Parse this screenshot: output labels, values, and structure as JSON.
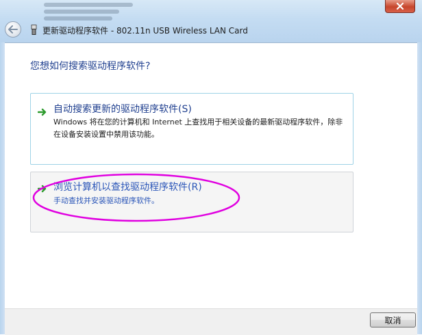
{
  "window": {
    "title": "更新驱动程序软件 - 802.11n USB Wireless LAN Card"
  },
  "content": {
    "question": "您想如何搜索驱动程序软件?",
    "options": [
      {
        "title": "自动搜索更新的驱动程序软件(S)",
        "description": "Windows 将在您的计算机和 Internet 上查找用于相关设备的最新驱动程序软件，除非在设备安装设置中禁用该功能。"
      },
      {
        "title": "浏览计算机以查找驱动程序软件(R)",
        "description": "手动查找并安装驱动程序软件。"
      }
    ]
  },
  "footer": {
    "cancel_label": "取消"
  },
  "colors": {
    "link_blue": "#1f3f8f",
    "option_border": "#9ed2e6",
    "arrow_green": "#2e9b2e",
    "annotation_magenta": "#e000e0"
  },
  "icons": {
    "back": "back-arrow-icon",
    "device": "device-icon",
    "option_arrow": "green-arrow-icon",
    "close": "close-icon"
  }
}
